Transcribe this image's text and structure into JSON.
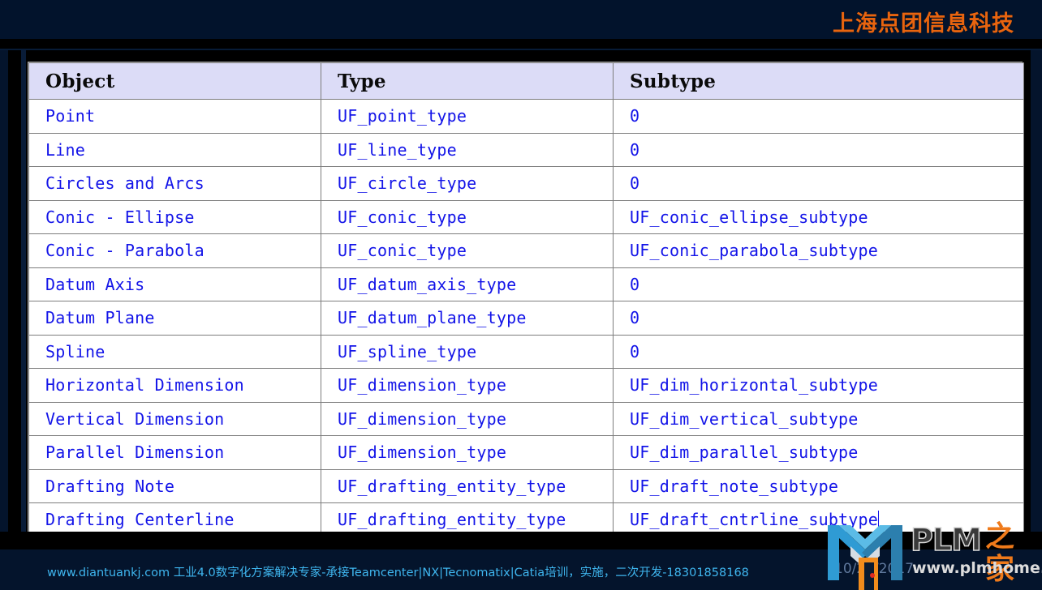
{
  "header": {
    "brand_title": "上海点团信息科技",
    "brand_color": "#e8640f"
  },
  "table": {
    "columns": [
      "Object",
      "Type",
      "Subtype"
    ],
    "rows": [
      {
        "object": "Point",
        "type": "UF_point_type",
        "subtype": "0"
      },
      {
        "object": "Line",
        "type": "UF_line_type",
        "subtype": "0"
      },
      {
        "object": "Circles and Arcs",
        "type": "UF_circle_type",
        "subtype": "0"
      },
      {
        "object": "Conic - Ellipse",
        "type": "UF_conic_type",
        "subtype": "UF_conic_ellipse_subtype"
      },
      {
        "object": "Conic - Parabola",
        "type": "UF_conic_type",
        "subtype": "UF_conic_parabola_subtype"
      },
      {
        "object": "Datum Axis",
        "type": "UF_datum_axis_type",
        "subtype": "0"
      },
      {
        "object": "Datum Plane",
        "type": "UF_datum_plane_type",
        "subtype": "0"
      },
      {
        "object": "Spline",
        "type": "UF_spline_type",
        "subtype": "0"
      },
      {
        "object": "Horizontal Dimension",
        "type": "UF_dimension_type",
        "subtype": "UF_dim_horizontal_subtype"
      },
      {
        "object": "Vertical Dimension",
        "type": "UF_dimension_type",
        "subtype": "UF_dim_vertical_subtype"
      },
      {
        "object": "Parallel Dimension",
        "type": "UF_dimension_type",
        "subtype": "UF_dim_parallel_subtype"
      },
      {
        "object": "Drafting Note",
        "type": "UF_drafting_entity_type",
        "subtype": "UF_draft_note_subtype"
      },
      {
        "object": "Drafting Centerline",
        "type": "UF_drafting_entity_type",
        "subtype": "UF_draft_cntrline_subtype"
      }
    ],
    "caret_row_index": 12,
    "header_bg": "#dcdcf7",
    "body_text_color": "#1314e8"
  },
  "footer": {
    "info_text": "www.diantuankj.com 工业4.0数字化方案解决专家-承接Teamcenter|NX|Tecnomatix|Catia培训，实施，二次开发-18301858168",
    "info_color": "#3fb6ef",
    "date": "10/25/2017",
    "date_color": "#5f789c"
  },
  "logo": {
    "letters": "PLM",
    "chinese": "之家",
    "url": "www.plmhome.com",
    "mark_color": "#2f9bd4",
    "mark_accent": "#f28c1c",
    "chinese_color": "#ef7a1a"
  }
}
